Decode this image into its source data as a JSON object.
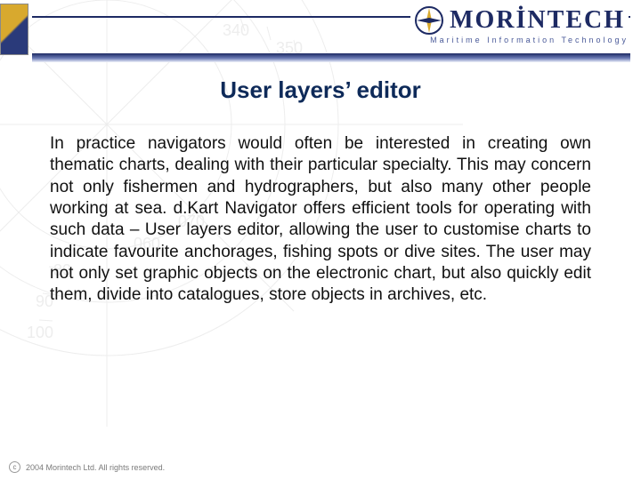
{
  "brand": {
    "name_prefix": "M",
    "name_rest": "ORİNTECH",
    "tagline": "Maritime Information Technology"
  },
  "slide": {
    "title": "User layers’ editor",
    "body": "In practice navigators would often be interested in creating own thematic charts, dealing with their particular specialty. This may concern not only fishermen and hydrographers, but also many other people working at sea. d.Kart Navigator offers efficient tools for operating with such data – User layers editor, allowing the user to customise charts to indicate favourite anchorages, fishing spots or dive sites. The user may not only set graphic objects on the electronic chart, but also quickly edit them, divide into catalogues, store objects in archives, etc."
  },
  "footer": {
    "copyright": "2004 Morintech Ltd. All rights reserved."
  }
}
